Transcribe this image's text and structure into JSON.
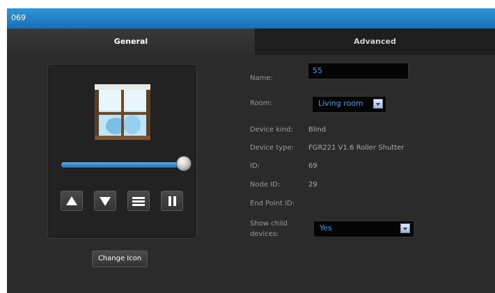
{
  "window": {
    "title": "069"
  },
  "tabs": {
    "general": "General",
    "advanced": "Advanced"
  },
  "device": {
    "icon": "window-blind-icon",
    "slider_level_percent": 95,
    "controls": [
      "open-up-icon",
      "close-down-icon",
      "menu-icon",
      "pause-icon"
    ],
    "change_icon_label": "Change Icon"
  },
  "fields": {
    "name_label": "Name:",
    "name_value": "55",
    "room_label": "Room:",
    "room_value": "Living room",
    "device_kind_label": "Device kind:",
    "device_kind_value": "Blind",
    "device_type_label": "Device type:",
    "device_type_value": "FGR221 V1.6 Roller Shutter",
    "id_label": "ID:",
    "id_value": "69",
    "node_id_label": "Node ID:",
    "node_id_value": "29",
    "end_point_id_label": "End Point ID:",
    "show_child_label": "Show child devices:",
    "show_child_value": "Yes"
  },
  "colors": {
    "accent": "#2d9ef0",
    "titlebar": "#1a6fb5",
    "panel": "#2b2b2b"
  }
}
